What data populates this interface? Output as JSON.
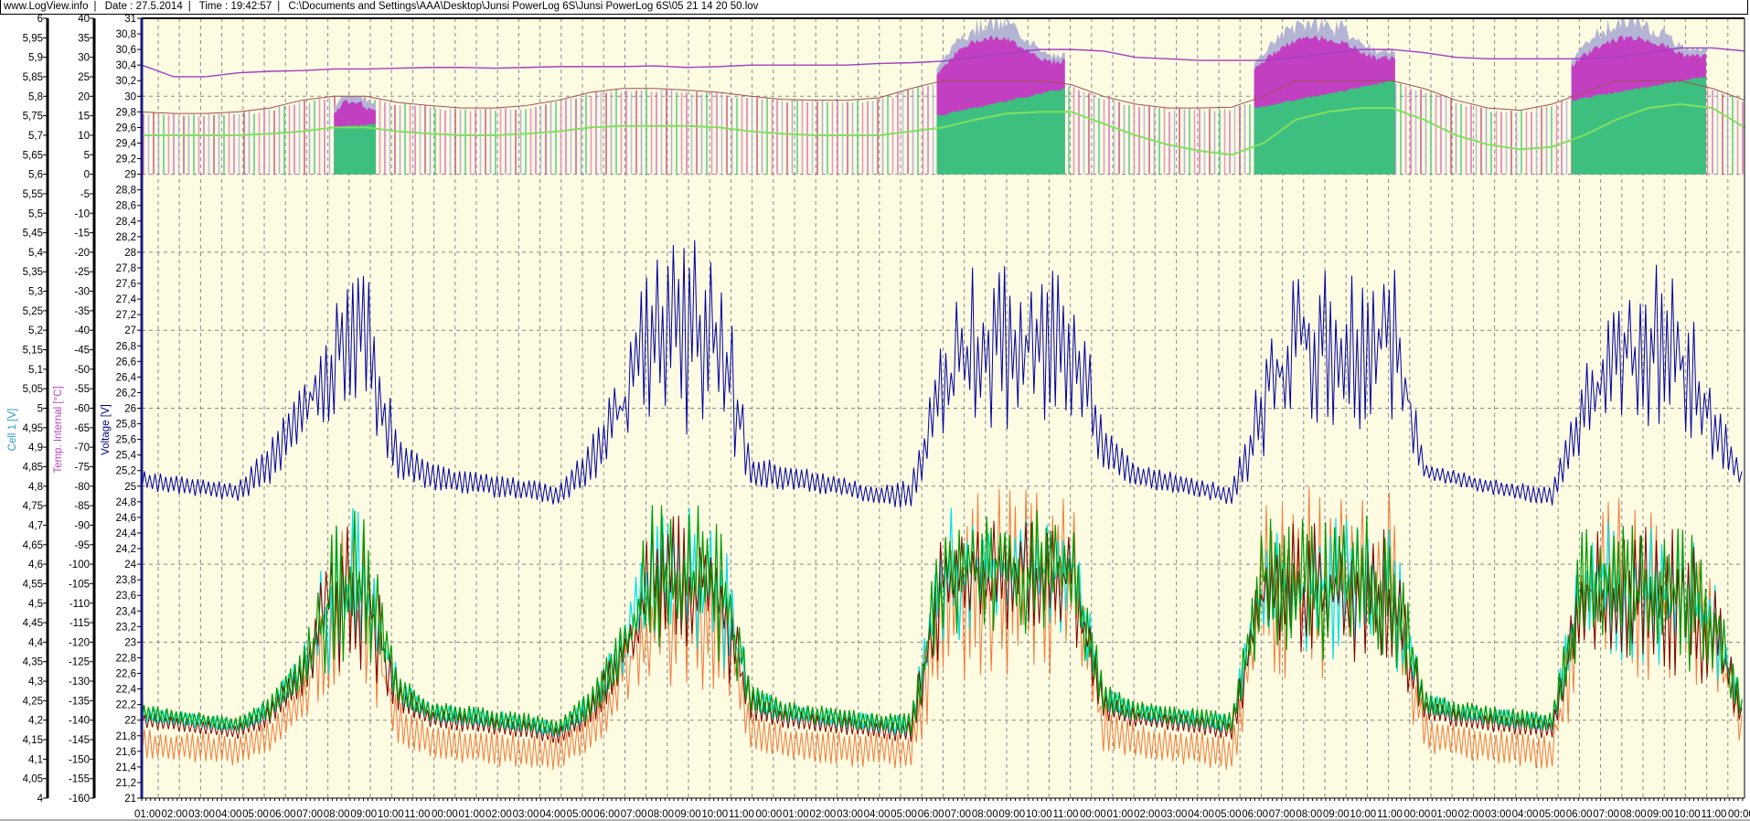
{
  "header": {
    "site": "www.LogView.info",
    "date": "Date : 27.5.2014",
    "time": "Time : 19:42:57",
    "file": "C:\\Documents and Settings\\AAA\\Desktop\\Junsi PowerLog 6S\\Junsi PowerLog 6S\\05 21 14 20 50.lov",
    "separator": "|"
  },
  "chart_data": {
    "type": "line",
    "title": "",
    "axes": {
      "cell": {
        "label": "Cell 1 [V]",
        "min": 4,
        "max": 6,
        "step": 0.05,
        "decimals": 2,
        "color": "#2a9bc8"
      },
      "temp": {
        "label": "Temp. Internal [°C]",
        "min": -160,
        "max": 40,
        "step": 5,
        "decimals": 0,
        "color": "#c040c0"
      },
      "voltage": {
        "label": "Voltage [V]",
        "min": 21,
        "max": 31,
        "step": 0.2,
        "decimals": 1,
        "color": "#000080"
      }
    },
    "x_tick_labels": [
      "01:00",
      "02:00",
      "03:00",
      "04:00",
      "05:00",
      "06:00",
      "07:00",
      "08:00",
      "09:00",
      "10:00",
      "11:00",
      "00:00",
      "01:00",
      "02:00",
      "03:00",
      "04:00",
      "05:00",
      "06:00",
      "07:00",
      "08:00",
      "09:00",
      "10:00",
      "11:00",
      "00:00",
      "01:00",
      "02:00",
      "03:00",
      "04:00",
      "05:00",
      "06:00",
      "07:00",
      "08:00",
      "09:00",
      "10:00",
      "11:00",
      "00:00",
      "01:00",
      "02:00",
      "03:00",
      "04:00",
      "05:00",
      "06:00",
      "07:00",
      "08:00",
      "09:00",
      "10:00",
      "11:00",
      "00:00",
      "01:00",
      "02:00",
      "03:00",
      "04:00",
      "05:00",
      "06:00",
      "07:00",
      "08:00",
      "09:00",
      "10:00",
      "11:00",
      "00:00"
    ],
    "grid": true,
    "colors": {
      "plot_bg": "#fdfbe1",
      "grid": "#8a8a8a",
      "voltage": "#0000a0",
      "cell_green": "#009a00",
      "cell_orange": "#f07c3c",
      "cell_red": "#800000",
      "cell_cyan": "#00e0e8",
      "fill_green": "#3dbf7f",
      "fill_magenta": "#c23fc2",
      "fill_gray": "#b4b4d4",
      "purple_line": "#a040c0",
      "brown_line": "#a05050",
      "green_line": "#80e060"
    },
    "series": {
      "voltage_low": [
        24.95,
        24.9,
        24.85,
        24.8,
        25.0,
        25.6,
        25.8,
        25.8,
        25.1,
        24.95,
        24.9,
        24.85,
        24.8,
        24.75,
        25.0,
        25.5,
        25.5,
        25.6,
        25.6,
        25.0,
        24.95,
        24.9,
        24.85,
        24.75,
        24.7,
        25.6,
        25.8,
        25.6,
        25.6,
        25.8,
        25.2,
        25.0,
        24.9,
        24.85,
        24.75,
        25.3,
        25.8,
        25.6,
        25.6,
        25.8,
        25.1,
        25.0,
        24.9,
        24.8,
        24.75,
        25.5,
        25.8,
        25.6,
        25.7,
        25.3,
        24.95
      ],
      "voltage_high": [
        25.2,
        25.15,
        25.1,
        25.05,
        25.6,
        26.3,
        27.4,
        28.0,
        25.6,
        25.3,
        25.2,
        25.15,
        25.1,
        25.0,
        25.6,
        26.6,
        28.4,
        28.4,
        28.5,
        25.4,
        25.3,
        25.2,
        25.1,
        25.0,
        25.1,
        27.0,
        27.9,
        27.9,
        27.8,
        28.3,
        25.8,
        25.3,
        25.2,
        25.1,
        25.0,
        26.9,
        27.9,
        27.8,
        27.8,
        28.2,
        25.3,
        25.2,
        25.1,
        25.05,
        25.0,
        26.5,
        27.8,
        27.9,
        27.8,
        26.3,
        25.1
      ],
      "cell_max_low": [
        4.2,
        4.19,
        4.18,
        4.17,
        4.2,
        4.28,
        4.33,
        4.35,
        4.24,
        4.2,
        4.19,
        4.18,
        4.17,
        4.16,
        4.2,
        4.3,
        4.38,
        4.38,
        4.35,
        4.22,
        4.2,
        4.19,
        4.18,
        4.17,
        4.16,
        4.4,
        4.42,
        4.42,
        4.42,
        4.42,
        4.22,
        4.2,
        4.19,
        4.18,
        4.17,
        4.4,
        4.35,
        4.35,
        4.35,
        4.35,
        4.22,
        4.2,
        4.19,
        4.18,
        4.17,
        4.4,
        4.33,
        4.33,
        4.33,
        4.3,
        4.2
      ],
      "cell_max_high": [
        4.24,
        4.23,
        4.22,
        4.21,
        4.26,
        4.38,
        4.75,
        4.75,
        4.32,
        4.25,
        4.24,
        4.23,
        4.22,
        4.2,
        4.28,
        4.45,
        4.78,
        4.76,
        4.75,
        4.3,
        4.25,
        4.24,
        4.23,
        4.22,
        4.22,
        4.75,
        4.75,
        4.75,
        4.75,
        4.75,
        4.3,
        4.25,
        4.24,
        4.23,
        4.22,
        4.72,
        4.73,
        4.73,
        4.73,
        4.73,
        4.28,
        4.25,
        4.24,
        4.23,
        4.22,
        4.72,
        4.72,
        4.72,
        4.72,
        4.6,
        4.23
      ],
      "cell_min_low": [
        4.1,
        4.09,
        4.09,
        4.08,
        4.12,
        4.2,
        4.25,
        4.25,
        4.14,
        4.1,
        4.09,
        4.08,
        4.08,
        4.07,
        4.12,
        4.2,
        4.25,
        4.25,
        4.25,
        4.12,
        4.1,
        4.09,
        4.08,
        4.08,
        4.07,
        4.3,
        4.3,
        4.3,
        4.3,
        4.3,
        4.12,
        4.1,
        4.09,
        4.08,
        4.07,
        4.3,
        4.3,
        4.3,
        4.3,
        4.3,
        4.12,
        4.1,
        4.09,
        4.08,
        4.07,
        4.3,
        4.3,
        4.3,
        4.3,
        4.25,
        4.12
      ],
      "cell_min_high": [
        4.18,
        4.17,
        4.17,
        4.16,
        4.2,
        4.3,
        4.7,
        4.7,
        4.25,
        4.19,
        4.18,
        4.17,
        4.17,
        4.16,
        4.22,
        4.4,
        4.7,
        4.7,
        4.7,
        4.22,
        4.19,
        4.18,
        4.17,
        4.17,
        4.16,
        4.75,
        4.8,
        4.8,
        4.8,
        4.8,
        4.25,
        4.19,
        4.18,
        4.17,
        4.16,
        4.78,
        4.8,
        4.8,
        4.8,
        4.8,
        4.22,
        4.19,
        4.18,
        4.17,
        4.16,
        4.75,
        4.78,
        4.78,
        4.78,
        4.6,
        4.18
      ],
      "purple_line": [
        30.4,
        30.25,
        30.25,
        30.3,
        30.32,
        30.33,
        30.35,
        30.35,
        30.36,
        30.37,
        30.37,
        30.36,
        30.37,
        30.38,
        30.38,
        30.38,
        30.39,
        30.37,
        30.38,
        30.4,
        30.4,
        30.4,
        30.4,
        30.42,
        30.43,
        30.45,
        30.5,
        30.55,
        30.6,
        30.6,
        30.58,
        30.5,
        30.48,
        30.46,
        30.46,
        30.46,
        30.5,
        30.55,
        30.6,
        30.6,
        30.56,
        30.5,
        30.48,
        30.48,
        30.48,
        30.48,
        30.5,
        30.56,
        30.62,
        30.62,
        30.58
      ],
      "brown_line": [
        29.8,
        29.78,
        29.78,
        29.8,
        29.85,
        29.95,
        30.0,
        30.0,
        29.92,
        29.88,
        29.85,
        29.85,
        29.88,
        29.95,
        30.05,
        30.1,
        30.1,
        30.08,
        30.05,
        30.0,
        29.96,
        29.95,
        29.95,
        29.98,
        30.1,
        30.2,
        30.2,
        30.2,
        30.2,
        30.15,
        30.0,
        29.9,
        29.85,
        29.85,
        29.86,
        30.0,
        30.2,
        30.2,
        30.2,
        30.2,
        30.1,
        29.95,
        29.85,
        29.82,
        29.9,
        30.05,
        30.2,
        30.2,
        30.2,
        30.1,
        29.95
      ],
      "green_line": [
        29.5,
        29.5,
        29.5,
        29.5,
        29.52,
        29.55,
        29.6,
        29.6,
        29.55,
        29.52,
        29.5,
        29.5,
        29.52,
        29.55,
        29.6,
        29.62,
        29.62,
        29.62,
        29.6,
        29.55,
        29.52,
        29.5,
        29.5,
        29.5,
        29.55,
        29.6,
        29.7,
        29.78,
        29.8,
        29.8,
        29.65,
        29.5,
        29.38,
        29.3,
        29.25,
        29.4,
        29.7,
        29.8,
        29.85,
        29.85,
        29.7,
        29.5,
        29.38,
        29.32,
        29.35,
        29.5,
        29.7,
        29.85,
        29.9,
        29.85,
        29.6
      ]
    },
    "fill_bursts": [
      {
        "start": 6.0,
        "end": 7.3,
        "green_top": [
          29.6,
          29.65
        ],
        "magenta_top": 29.95,
        "gray_top": 30.0
      },
      {
        "start": 24.8,
        "end": 28.8,
        "green_top": [
          29.75,
          30.1
        ],
        "magenta_top": 30.75,
        "gray_top": 31.0
      },
      {
        "start": 34.7,
        "end": 39.1,
        "green_top": [
          29.85,
          30.2
        ],
        "magenta_top": 30.75,
        "gray_top": 31.0
      },
      {
        "start": 44.6,
        "end": 48.8,
        "green_top": [
          29.95,
          30.25
        ],
        "magenta_top": 30.75,
        "gray_top": 31.0
      }
    ]
  }
}
